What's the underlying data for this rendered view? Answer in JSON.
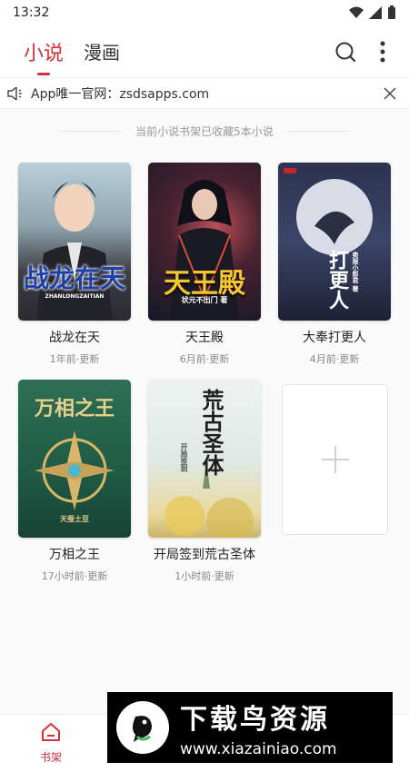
{
  "status_bar": {
    "time": "13:32"
  },
  "tabs": [
    {
      "label": "小说",
      "active": true
    },
    {
      "label": "漫画",
      "active": false
    }
  ],
  "notice": {
    "text": "App唯一官网：zsdsapps.com"
  },
  "shelf": {
    "count_text": "当前小说书架已收藏5本小说"
  },
  "books": [
    {
      "title": "战龙在天",
      "meta": "1年前·更新",
      "cover_text": "战龙在天",
      "cover_sub": "ZHANLONGZAITIAN"
    },
    {
      "title": "天王殿",
      "meta": "6月前·更新",
      "cover_text": "天王殿",
      "cover_sub": "状元不出门 著"
    },
    {
      "title": "大奉打更人",
      "meta": "4月前·更新",
      "cover_text": "打更人",
      "cover_sub": "卖报小郎君 著"
    },
    {
      "title": "万相之王",
      "meta": "17小时前·更新",
      "cover_text": "万相之王",
      "cover_sub": "天蚕土豆"
    },
    {
      "title": "开局签到荒古圣体",
      "meta": "1小时前·更新",
      "cover_text": "荒古圣体",
      "cover_sub": "开局签到"
    }
  ],
  "bottom_nav": {
    "shelf_label": "书架"
  },
  "watermark": {
    "title": "下载鸟资源",
    "url": "www.xiazainiao.com"
  },
  "colors": {
    "accent": "#d6303a"
  },
  "icons": [
    "wifi-icon",
    "signal-icon",
    "battery-icon",
    "search-icon",
    "more-vertical-icon",
    "speaker-icon",
    "close-icon",
    "plus-icon",
    "home-icon"
  ]
}
